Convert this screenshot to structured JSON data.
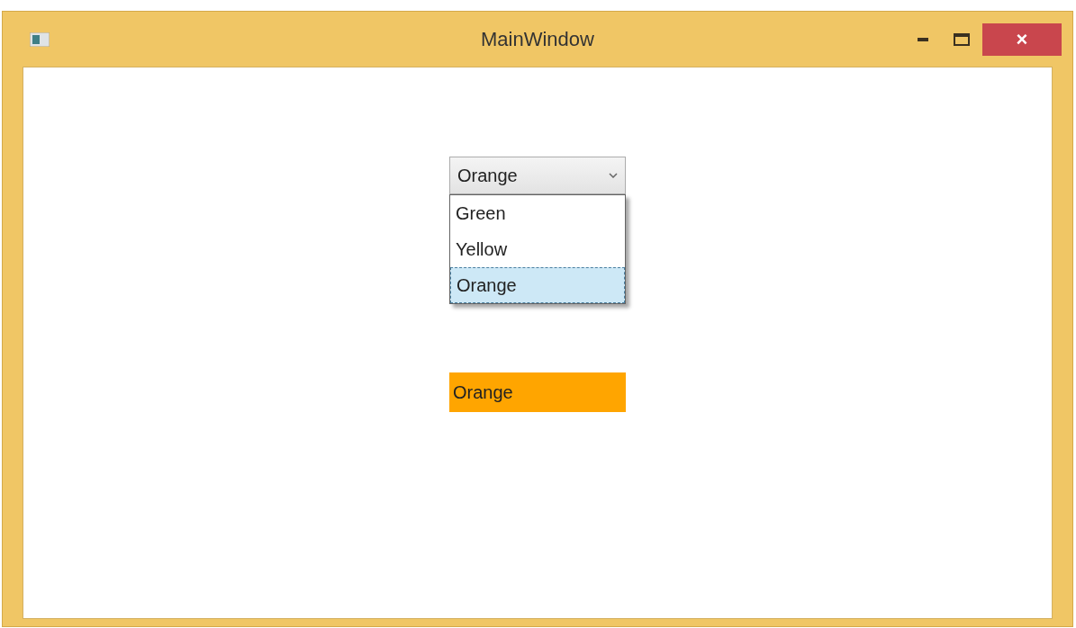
{
  "window": {
    "title": "MainWindow",
    "close_button": "×"
  },
  "combo_box": {
    "value": "Orange",
    "expanded": true,
    "options": [
      {
        "label": "Green",
        "selected": false
      },
      {
        "label": "Yellow",
        "selected": false
      },
      {
        "label": "Orange",
        "selected": true
      }
    ]
  },
  "text_block": {
    "text": "Orange",
    "color": "#ffa500"
  }
}
